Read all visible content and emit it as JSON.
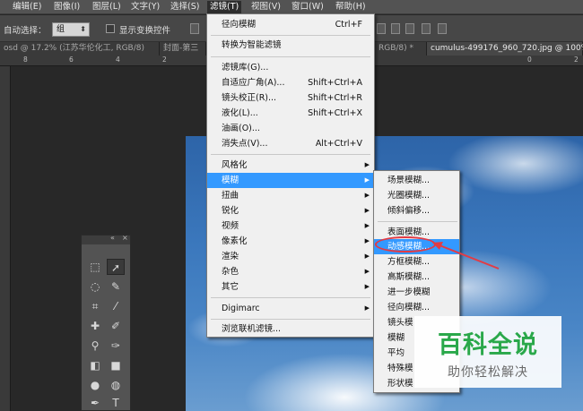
{
  "menubar": {
    "items": [
      {
        "label": "编辑(E)"
      },
      {
        "label": "图像(I)"
      },
      {
        "label": "图层(L)"
      },
      {
        "label": "文字(Y)"
      },
      {
        "label": "选择(S)"
      },
      {
        "label": "滤镜(T)"
      },
      {
        "label": "视图(V)"
      },
      {
        "label": "窗口(W)"
      },
      {
        "label": "帮助(H)"
      }
    ],
    "active_label": "滤镜(T)"
  },
  "options": {
    "auto_select_label": "自动选择：",
    "auto_select_value": "组",
    "show_transform_label": "显示变换控件"
  },
  "tabs": [
    {
      "label": "osd @ 17.2% (江苏华伦化工, RGB/8)"
    },
    {
      "label": "封面-第三"
    },
    {
      "label": "RGB/8) *"
    },
    {
      "label": "cumulus-499176_960_720.jpg @ 100%"
    }
  ],
  "ruler": [
    "8",
    "6",
    "4",
    "2",
    "0",
    "2"
  ],
  "filter_menu": {
    "items": [
      {
        "label": "径向模糊",
        "shortcut": "Ctrl+F"
      },
      {
        "label": "转换为智能滤镜",
        "shortcut": ""
      },
      {
        "label": "滤镜库(G)...",
        "shortcut": ""
      },
      {
        "label": "自适应广角(A)...",
        "shortcut": "Shift+Ctrl+A"
      },
      {
        "label": "镜头校正(R)...",
        "shortcut": "Shift+Ctrl+R"
      },
      {
        "label": "液化(L)...",
        "shortcut": "Shift+Ctrl+X"
      },
      {
        "label": "油画(O)...",
        "shortcut": ""
      },
      {
        "label": "消失点(V)...",
        "shortcut": "Alt+Ctrl+V"
      },
      {
        "label": "风格化",
        "shortcut": ""
      },
      {
        "label": "模糊",
        "shortcut": ""
      },
      {
        "label": "扭曲",
        "shortcut": ""
      },
      {
        "label": "锐化",
        "shortcut": ""
      },
      {
        "label": "视频",
        "shortcut": ""
      },
      {
        "label": "像素化",
        "shortcut": ""
      },
      {
        "label": "渲染",
        "shortcut": ""
      },
      {
        "label": "杂色",
        "shortcut": ""
      },
      {
        "label": "其它",
        "shortcut": ""
      },
      {
        "label": "Digimarc",
        "shortcut": ""
      },
      {
        "label": "浏览联机滤镜...",
        "shortcut": ""
      }
    ]
  },
  "blur_submenu": {
    "items": [
      {
        "label": "场景模糊..."
      },
      {
        "label": "光圈模糊..."
      },
      {
        "label": "倾斜偏移..."
      },
      {
        "label": "表面模糊..."
      },
      {
        "label": "动感模糊..."
      },
      {
        "label": "方框模糊..."
      },
      {
        "label": "高斯模糊..."
      },
      {
        "label": "进一步模糊"
      },
      {
        "label": "径向模糊..."
      },
      {
        "label": "镜头模"
      },
      {
        "label": "模糊"
      },
      {
        "label": "平均"
      },
      {
        "label": "特殊模"
      },
      {
        "label": "形状模"
      }
    ]
  },
  "watermark": {
    "title": "百科全说",
    "subtitle": "助你轻松解决"
  },
  "colors": {
    "highlight": "#3399ff",
    "annotation": "#e33b44",
    "watermark_green": "#2aa84a"
  }
}
